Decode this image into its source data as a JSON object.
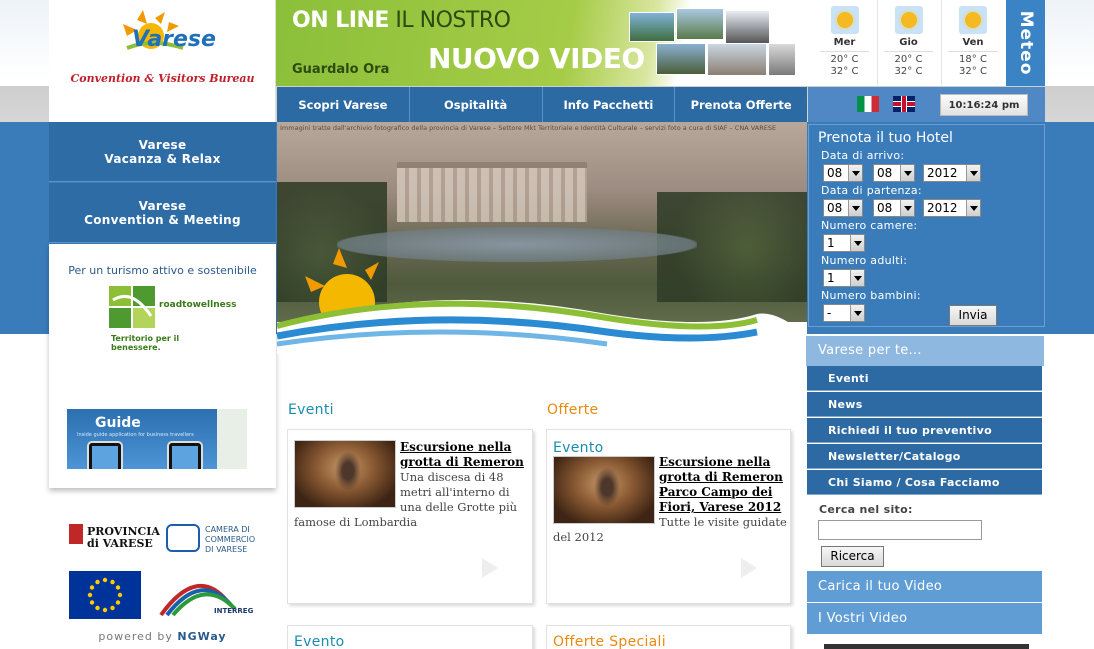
{
  "logo": {
    "brand": "Varese",
    "subtitle": "Convention & Visitors Bureau"
  },
  "left_menu": [
    {
      "line1": "Varese",
      "line2": "Vacanza & Relax"
    },
    {
      "line1": "Varese",
      "line2": "Convention & Meeting"
    }
  ],
  "left_panel": {
    "tagline": "Per un turismo attivo e sostenibile",
    "rtw_name": "roadtowellness",
    "rtw_claim": "Territorio per il benessere.",
    "guide_title": "Guide",
    "guide_sub": "Inside guide application for business travellers"
  },
  "sponsors": {
    "provincia_small": "PROVINCIA",
    "provincia_main": "di VARESE",
    "camera_line1": "CAMERA DI",
    "camera_line2": "COMMERCIO",
    "camera_line3": "DI VARESE",
    "interreg": "INTERREG",
    "powered_prefix": "powered by",
    "powered_brand": "NGWay"
  },
  "banner": {
    "line1_bold": "ON LINE",
    "line1_rest": " IL NOSTRO",
    "line2": "NUOVO VIDEO",
    "cta": "Guardalo Ora"
  },
  "weather": {
    "tab_label": "Meteo",
    "days": [
      {
        "name": "Mer",
        "icon": "sun-icon",
        "t1": "20° C",
        "t2": "32° C"
      },
      {
        "name": "Gio",
        "icon": "sun-cloud-icon",
        "t1": "20° C",
        "t2": "32° C"
      },
      {
        "name": "Ven",
        "icon": "sun-icon",
        "t1": "18° C",
        "t2": "32° C"
      }
    ]
  },
  "nav": [
    "Scopri Varese",
    "Ospitalità",
    "Info Pacchetti",
    "Prenota Offerte"
  ],
  "clock": "10:16:24 pm",
  "hero": {
    "credit": "Immagini tratte dall'archivio fotografico della provincia di Varese – Settore Mkt Territoriale e Identità Culturale – servizi foto a cura di SIAF – CNA VARESE"
  },
  "booking": {
    "title": "Prenota il tuo Hotel",
    "arrival_label": "Data di arrivo:",
    "departure_label": "Data di partenza:",
    "rooms_label": "Numero camere:",
    "adults_label": "Numero adulti:",
    "children_label": "Numero bambini:",
    "arrival": {
      "day": "08",
      "month": "08",
      "year": "2012"
    },
    "departure": {
      "day": "08",
      "month": "08",
      "year": "2012"
    },
    "rooms": "1",
    "adults": "1",
    "children": "-",
    "submit": "Invia"
  },
  "sidebar": {
    "heading": "Varese per te...",
    "items": [
      "Eventi",
      "News",
      "Richiedi il tuo preventivo",
      "Newsletter/Catalogo",
      "Chi Siamo / Cosa Facciamo"
    ],
    "search_label": "Cerca nel sito:",
    "search_value": "",
    "search_button": "Ricerca",
    "upload_video": "Carica il tuo Video",
    "your_videos": "I Vostri Video"
  },
  "colors": {
    "accent_blue": "#2d6aa3",
    "events_title": "#1a8cb0",
    "offers_title": "#e88a10",
    "banner_green": "#8bbf3a"
  },
  "sections": {
    "eventi_title": "Eventi",
    "offerte_title": "Offerte",
    "evento_bottom": "Evento",
    "offerte_speciali": "Offerte Speciali"
  },
  "cards": {
    "event": {
      "title_line1": "Escursione nella",
      "title_line2": "grotta di Remeron ",
      "text_lines": [
        "Una discesa di 48",
        "metri all'interno di",
        "una delle Grotte più"
      ],
      "text_tail": "famose di Lombardia"
    },
    "offer": {
      "sub": "Evento",
      "title_lines": [
        "Escursione nella",
        "grotta di Remeron -",
        "Parco Campo dei",
        "Fiori, Varese 2012"
      ],
      "text_line": "Tutte le visite guidate",
      "text_tail": "del 2012"
    }
  }
}
